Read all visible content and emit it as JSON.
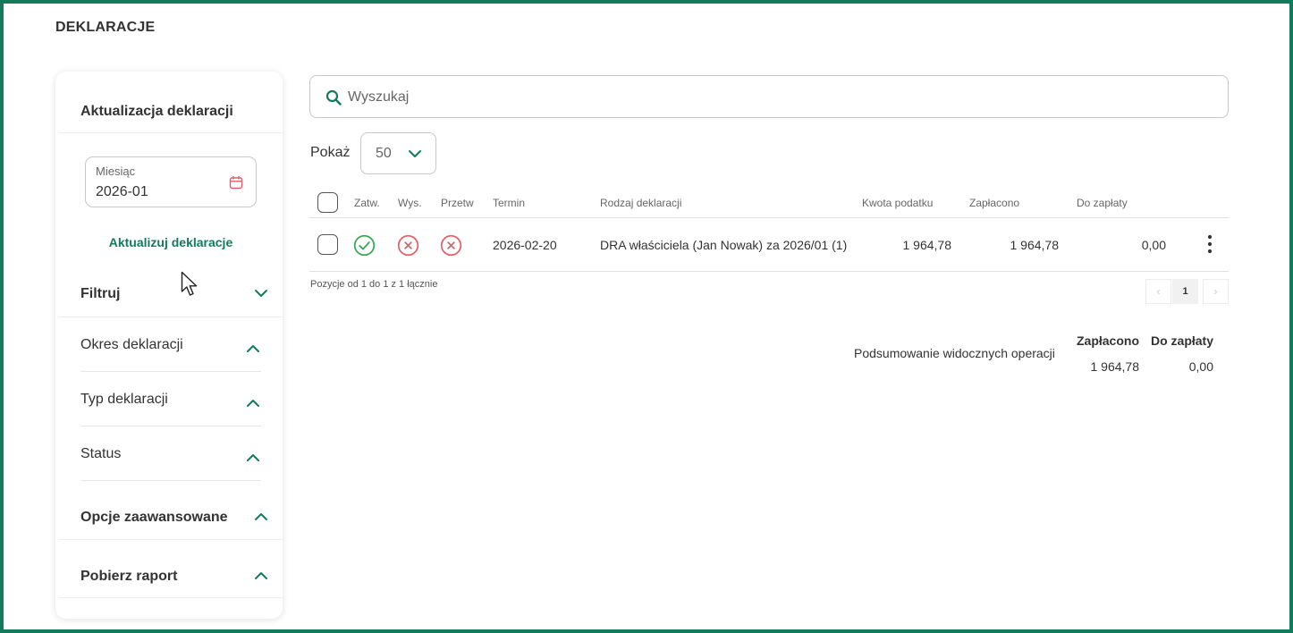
{
  "page": {
    "title": "DEKLARACJE"
  },
  "sidebar": {
    "update_title": "Aktualizacja deklaracji",
    "month_label": "Miesiąc",
    "month_value": "2026-01",
    "update_link": "Aktualizuj deklaracje",
    "filter_title": "Filtruj",
    "filters": [
      {
        "label": "Okres deklaracji"
      },
      {
        "label": "Typ deklaracji"
      },
      {
        "label": "Status"
      }
    ],
    "advanced_title": "Opcje zaawansowane",
    "report_title": "Pobierz raport"
  },
  "search": {
    "placeholder": "Wyszukaj",
    "value": ""
  },
  "show": {
    "label": "Pokaż",
    "value": "50"
  },
  "table": {
    "headers": {
      "approved": "Zatw.",
      "sent": "Wys.",
      "processed": "Przetw",
      "deadline": "Termin",
      "type": "Rodzaj deklaracji",
      "tax_amount": "Kwota podatku",
      "paid": "Zapłacono",
      "due": "Do zapłaty"
    },
    "rows": [
      {
        "approved": true,
        "sent": false,
        "processed": false,
        "deadline": "2026-02-20",
        "type": "DRA właściciela (Jan Nowak) za 2026/01 (1)",
        "tax_amount": "1 964,78",
        "paid": "1 964,78",
        "due": "0,00"
      }
    ]
  },
  "pagination": {
    "info": "Pozycje od 1 do 1 z 1 łącznie",
    "prev": "‹",
    "current": "1",
    "next": "›"
  },
  "summary": {
    "label": "Podsumowanie widocznych operacji",
    "paid_header": "Zapłacono",
    "due_header": "Do zapłaty",
    "paid_value": "1 964,78",
    "due_value": "0,00"
  },
  "colors": {
    "accent": "#137a5c",
    "success": "#3aa655",
    "danger": "#e0606a"
  }
}
